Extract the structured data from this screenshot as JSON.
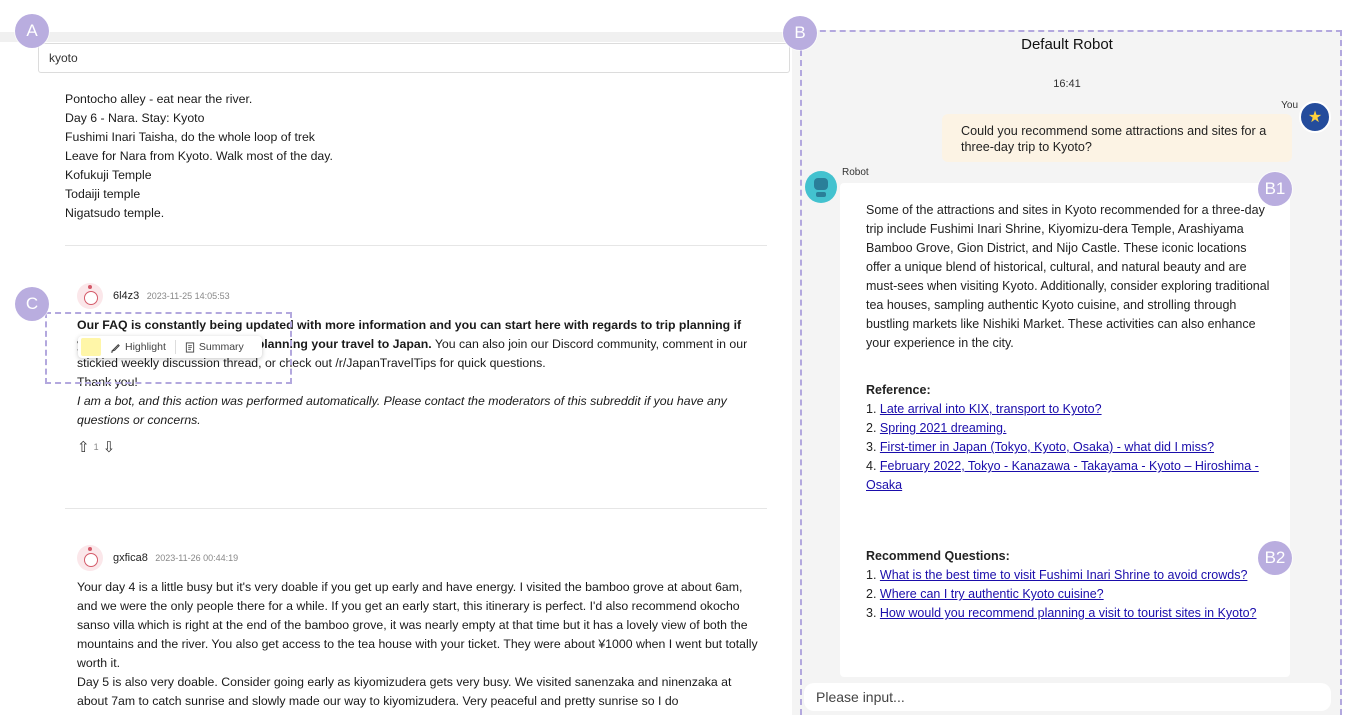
{
  "search": {
    "value": "kyoto"
  },
  "first_post": {
    "lines": [
      "Pontocho alley - eat near the river.",
      "Day 6 - Nara. Stay: Kyoto",
      "Fushimi Inari Taisha, do the whole loop of trek",
      "Leave for Nara from Kyoto. Walk most of the day.",
      "Kofukuji Temple",
      "Todaiji temple",
      "Nigatsudo temple."
    ]
  },
  "comments": [
    {
      "user": "6l4z3",
      "time": "2023-11-25 14:05:53",
      "bold_text": "Our FAQ is constantly being updated with more information and you can start here with regards to trip planning if you have any questions about planning your travel to Japan.",
      "text": " You can also join our Discord community, comment in our stickied weekly discussion thread, or check out /r/JapanTravelTips for quick questions.",
      "thanks": "Thank you!",
      "italic": "I am a bot, and this action was performed automatically. Please contact the moderators of this subreddit if you have any questions or concerns.",
      "votes": "1"
    },
    {
      "user": "gxfica8",
      "time": "2023-11-26 00:44:19",
      "para1": "Your day 4 is a little busy but it's very doable if you get up early and have energy. I visited the bamboo grove at about 6am, and we were the only people there for a while. If you get an early start, this itinerary is perfect. I'd also recommend okocho sanso villa which is right at the end of the bamboo grove, it was nearly empty at that time but it has a lovely view of both the mountains and the river. You also get access to the tea house with your ticket. They were about ¥1000 when I went but totally worth it.",
      "para2": "Day 5 is also very doable. Consider going early as kiyomizudera gets very busy. We visited sanenzaka and ninenzaka at about 7am to catch sunrise and slowly made our way to kiyomizudera. Very peaceful and pretty sunrise so I do"
    }
  ],
  "selection_toolbar": {
    "highlight": "Highlight",
    "summary": "Summary"
  },
  "chat": {
    "title": "Default Robot",
    "time": "16:41",
    "user_label": "You",
    "user_message": "Could you recommend some attractions and sites for a three-day trip to Kyoto?",
    "robot_label": "Robot",
    "answer": "Some of the attractions and sites in Kyoto recommended for a three-day trip include Fushimi Inari Shrine, Kiyomizu-dera Temple, Arashiyama Bamboo Grove, Gion District, and Nijo Castle. These iconic locations offer a unique blend of historical, cultural, and natural beauty and are must-sees when visiting Kyoto. Additionally, consider exploring traditional tea houses, sampling authentic Kyoto cuisine, and strolling through bustling markets like Nishiki Market. These activities can also enhance your experience in the city.",
    "reference_title": "Reference:",
    "references": [
      {
        "num": "1. ",
        "text": "Late arrival into KIX, transport to Kyoto?"
      },
      {
        "num": "2. ",
        "text": "Spring 2021 dreaming."
      },
      {
        "num": "3. ",
        "text": "First-timer in Japan (Tokyo, Kyoto, Osaka) - what did I miss?"
      },
      {
        "num": "4. ",
        "text": "February 2022, Tokyo - Kanazawa - Takayama - Kyoto – Hiroshima - Osaka"
      }
    ],
    "questions_title": "Recommend Questions:",
    "questions": [
      {
        "num": "1. ",
        "text": "What is the best time to visit Fushimi Inari Shrine to avoid crowds?"
      },
      {
        "num": "2. ",
        "text": "Where can I try authentic Kyoto cuisine?"
      },
      {
        "num": "3. ",
        "text": "How would you recommend planning a visit to tourist sites in Kyoto?"
      }
    ],
    "input_placeholder": "Please input..."
  },
  "annotations": {
    "a": "A",
    "b": "B",
    "b1": "B1",
    "b2": "B2",
    "c": "C"
  },
  "colors": {
    "accent": "#b9addf",
    "link": "#1a0dab",
    "user_bubble": "#fcf3e4"
  }
}
